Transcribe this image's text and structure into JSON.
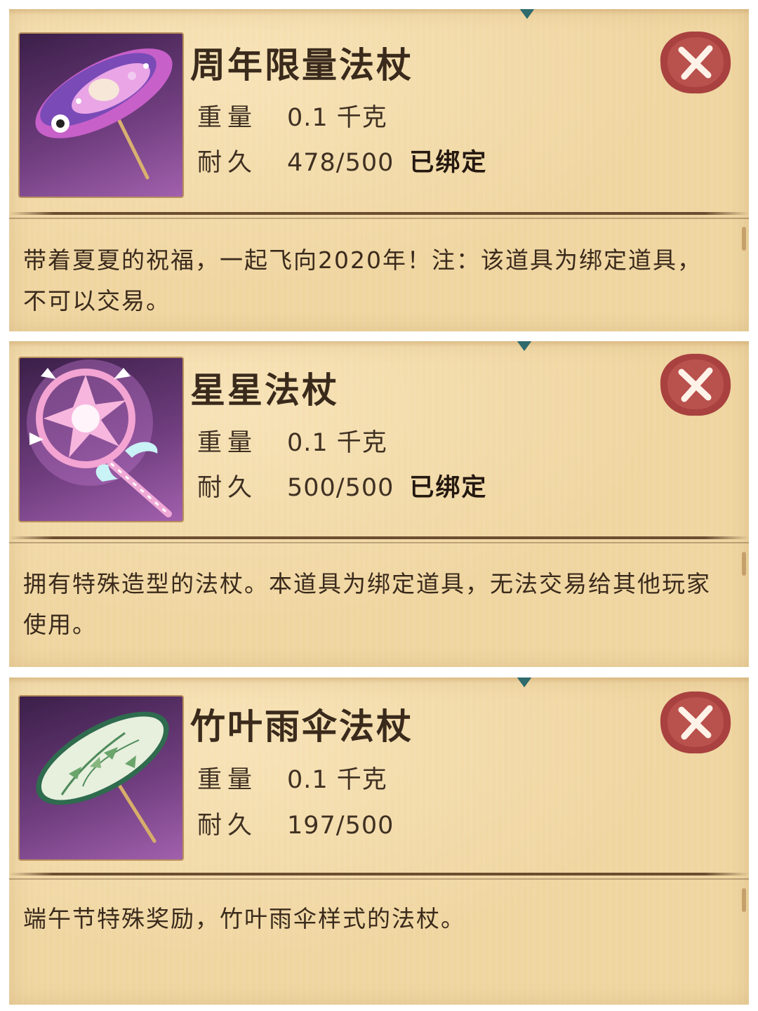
{
  "items": [
    {
      "name": "周年限量法杖",
      "weight_label": "重量",
      "weight_value": "0.1 千克",
      "durability_label": "耐久",
      "durability_value": "478/500",
      "bound_label": "已绑定",
      "description": "带着夏夏的祝福，一起飞向2020年！注：该道具为绑定道具，不可以交易。",
      "icon": "parasol-staff-icon"
    },
    {
      "name": "星星法杖",
      "weight_label": "重量",
      "weight_value": "0.1 千克",
      "durability_label": "耐久",
      "durability_value": "500/500",
      "bound_label": "已绑定",
      "description": "拥有特殊造型的法杖。本道具为绑定道具，无法交易给其他玩家使用。",
      "icon": "star-wand-icon"
    },
    {
      "name": "竹叶雨伞法杖",
      "weight_label": "重量",
      "weight_value": "0.1 千克",
      "durability_label": "耐久",
      "durability_value": "197/500",
      "bound_label": "",
      "description": "端午节特殊奖励，竹叶雨伞样式的法杖。",
      "icon": "bamboo-umbrella-staff-icon"
    }
  ],
  "colors": {
    "panel": "#efd5a0",
    "text": "#3a2a1c",
    "close_seal": "#a8413f",
    "icon_bg": "#6d3c7c"
  },
  "close_icon": "close-seal-icon"
}
